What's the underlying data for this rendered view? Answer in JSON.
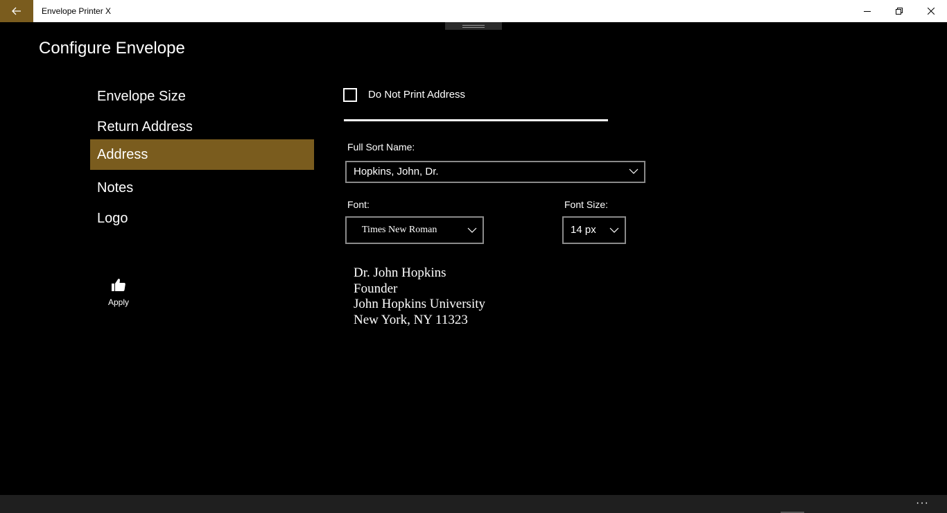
{
  "window": {
    "title": "Envelope Printer X",
    "accent_color": "#7a5c1e",
    "back_icon": "arrow-left-icon",
    "minimize_icon": "minimize-icon",
    "maximize_icon": "restore-icon",
    "close_icon": "close-icon"
  },
  "page": {
    "title": "Configure Envelope"
  },
  "sidebar": {
    "items": [
      {
        "label": "Envelope Size",
        "active": false
      },
      {
        "label": "Return Address",
        "active": false
      },
      {
        "label": "Address",
        "active": true
      },
      {
        "label": "Notes",
        "active": false
      },
      {
        "label": "Logo",
        "active": false
      }
    ],
    "apply": {
      "label": "Apply",
      "icon": "thumbs-up-icon"
    }
  },
  "form": {
    "do_not_print": {
      "label": "Do Not Print Address",
      "checked": false
    },
    "full_sort_name": {
      "label": "Full Sort Name:",
      "value": "Hopkins, John, Dr."
    },
    "font": {
      "label": "Font:",
      "value": "Times New Roman"
    },
    "font_size": {
      "label": "Font Size:",
      "value": "14 px"
    }
  },
  "preview": {
    "lines": [
      "Dr. John Hopkins",
      "Founder",
      "John Hopkins University",
      "New York, NY 11323"
    ]
  },
  "appbar": {
    "more_label": "···"
  }
}
